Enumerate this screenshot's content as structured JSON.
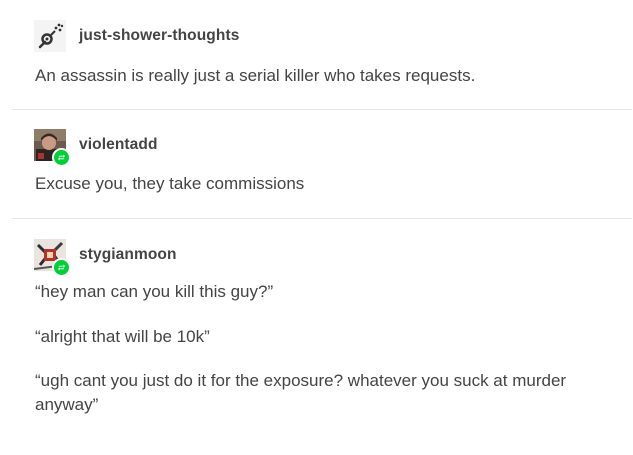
{
  "posts": [
    {
      "username": "just-shower-thoughts",
      "avatar_icon": "shower-head-icon",
      "paragraphs": [
        "An assassin is really just a serial killer who takes requests."
      ]
    },
    {
      "username": "violentadd",
      "avatar_icon": "profile-photo",
      "reblog": true,
      "paragraphs": [
        "Excuse you, they take commissions"
      ]
    },
    {
      "username": "stygianmoon",
      "avatar_icon": "profile-photo",
      "reblog": true,
      "paragraphs": [
        "“hey man can you kill this guy?”",
        "“alright that will be 10k”",
        "“ugh cant you just do it for the exposure? whatever you suck at murder anyway”"
      ]
    }
  ],
  "colors": {
    "text": "#444444",
    "divider": "#e7e7e7",
    "reblog_badge": "#00cf35"
  }
}
